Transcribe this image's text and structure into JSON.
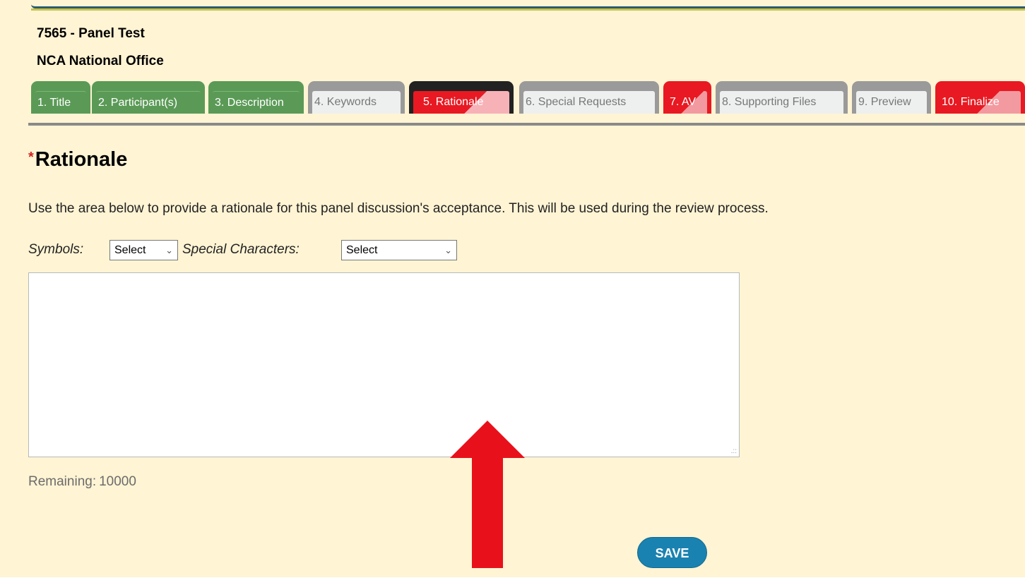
{
  "proposal": {
    "id_title": "7565 - Panel Test",
    "organization": "NCA National Office"
  },
  "tabs": [
    {
      "label": "1. Title",
      "state": "complete"
    },
    {
      "label": "2. Participant(s)",
      "state": "complete"
    },
    {
      "label": "3. Description",
      "state": "complete"
    },
    {
      "label": "4. Keywords",
      "state": "optional"
    },
    {
      "label": "5. Rationale",
      "state": "required-active"
    },
    {
      "label": "6. Special Requests",
      "state": "optional"
    },
    {
      "label": "7. AV",
      "state": "required"
    },
    {
      "label": "8. Supporting Files",
      "state": "optional"
    },
    {
      "label": "9. Preview",
      "state": "optional"
    },
    {
      "label": "10. Finalize",
      "state": "required"
    }
  ],
  "section": {
    "required_marker": "*",
    "title": "Rationale",
    "instructions": "Use the area below to provide a rationale for this panel discussion's acceptance. This will be used during the review process."
  },
  "tools": {
    "symbols_label": "Symbols:",
    "symbols_value": "Select",
    "special_label": "Special Characters:",
    "special_value": "Select"
  },
  "editor": {
    "value": ""
  },
  "remaining": {
    "label": "Remaining:",
    "count": "10000"
  },
  "actions": {
    "save_label": "SAVE"
  },
  "colors": {
    "page_bg": "#fff4d4",
    "tab_complete": "#5a9a56",
    "tab_required": "#e81922",
    "tab_optional": "#eef0f0",
    "save_button": "#1a82b0",
    "annotation_arrow": "#e8111b"
  },
  "icons": {
    "dropdown": "chevron-down-icon",
    "annotation": "up-arrow-icon"
  }
}
